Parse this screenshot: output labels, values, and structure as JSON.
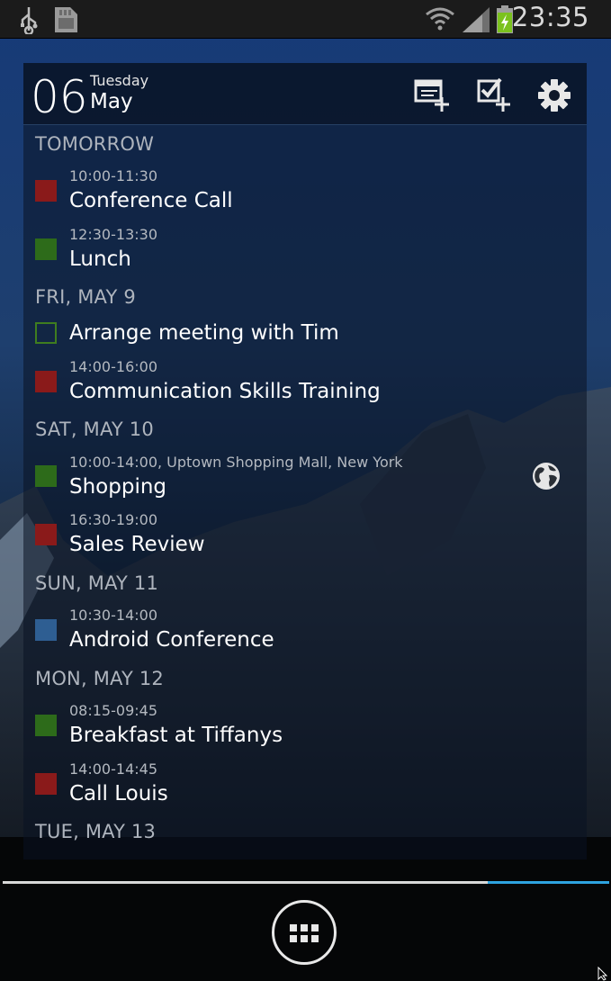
{
  "status_bar": {
    "time": "23:35",
    "icons": [
      "usb-icon",
      "sd-card-icon",
      "wifi-icon",
      "signal-icon",
      "battery-charging-icon"
    ]
  },
  "widget": {
    "header": {
      "day": "06",
      "weekday": "Tuesday",
      "month": "May",
      "buttons": [
        "add-event-icon",
        "add-task-icon",
        "settings-icon"
      ]
    },
    "sections": [
      {
        "heading": "TOMORROW",
        "events": [
          {
            "time": "10:00-11:30",
            "title": "Conference Call",
            "color": "#8a1a1a",
            "kind": "event"
          },
          {
            "time": "12:30-13:30",
            "title": "Lunch",
            "color": "#2d6b1a",
            "kind": "event"
          }
        ]
      },
      {
        "heading": "FRI, MAY 9",
        "events": [
          {
            "time": "",
            "title": "Arrange meeting with Tim",
            "color": "#3f7d1f",
            "kind": "task"
          },
          {
            "time": "14:00-16:00",
            "title": "Communication Skills Training",
            "color": "#8a1a1a",
            "kind": "event"
          }
        ]
      },
      {
        "heading": "SAT, MAY 10",
        "events": [
          {
            "time": "10:00-14:00, Uptown Shopping Mall, New York",
            "title": "Shopping",
            "color": "#2d6b1a",
            "kind": "event"
          },
          {
            "time": "16:30-19:00",
            "title": "Sales Review",
            "color": "#8a1a1a",
            "kind": "event"
          }
        ]
      },
      {
        "heading": "SUN, MAY 11",
        "events": [
          {
            "time": "10:30-14:00",
            "title": "Android Conference",
            "color": "#2e5e92",
            "kind": "event"
          }
        ]
      },
      {
        "heading": "MON, MAY 12",
        "events": [
          {
            "time": "08:15-09:45",
            "title": "Breakfast at Tiffanys",
            "color": "#2d6b1a",
            "kind": "event"
          },
          {
            "time": "14:00-14:45",
            "title": "Call Louis",
            "color": "#8a1a1a",
            "kind": "event"
          }
        ]
      },
      {
        "heading": "TUE, MAY 13",
        "events": []
      }
    ]
  },
  "home_screen": {
    "page_indicator": {
      "pages": 5,
      "current": 5
    },
    "app_drawer_icon": "app-drawer-icon",
    "widget_icon": "globe-icon"
  },
  "colors": {
    "accent": "#2ea3e0",
    "red": "#8a1a1a",
    "green": "#2d6b1a",
    "blue": "#2e5e92"
  }
}
